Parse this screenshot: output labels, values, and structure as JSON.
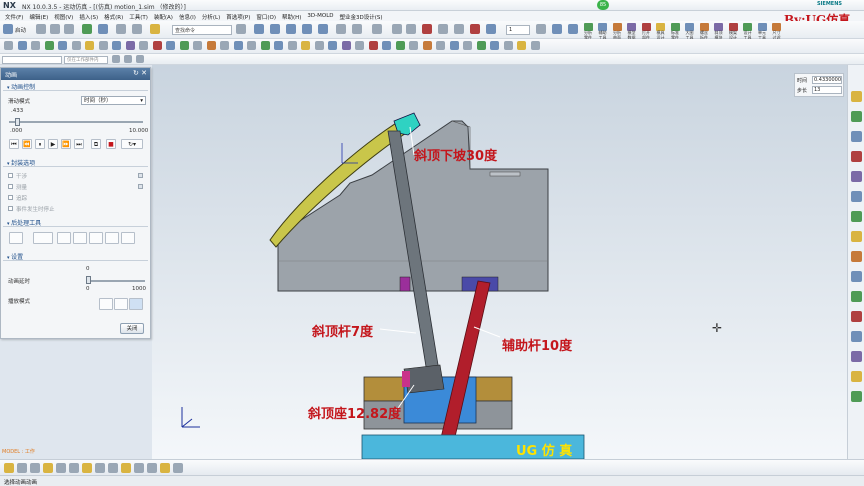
{
  "app": {
    "logo": "NX",
    "title": "NX 10.0.3.5 - 运动仿真 - [(仿真) motion_1.sim （修改的）]",
    "vendor": "SIEMENS",
    "badge": "85",
    "watermark": "By:UG仿真"
  },
  "menu": [
    "文件(F)",
    "编辑(E)",
    "视图(V)",
    "插入(S)",
    "格式(R)",
    "工具(T)",
    "装配(A)",
    "信息(I)",
    "分析(L)",
    "首选项(P)",
    "窗口(O)",
    "帮助(H)",
    "3D-MOLD",
    "塑业金3D设计(S)"
  ],
  "toolbar": {
    "start_menu": "启动",
    "search_placeholder": "查找命令",
    "step_value": "1",
    "filter_placeholder": "仅在工作部件内"
  },
  "ribbon_groups": [
    "分析\n零件",
    "辅助\n工具",
    "分析\n曲面",
    "模型\n数据",
    "打开\n部件",
    "模具\n设计",
    "标准\n零件",
    "大图\n工具",
    "螺丝\n拆件",
    "斜顶\n模块",
    "模架\n设计",
    "设计\n工具",
    "单元\n工具",
    "尺寸\n过滤"
  ],
  "dialog": {
    "title": "动画",
    "sec_anim": "动画控制",
    "playback_mode_label": "滑动模式",
    "playback_mode_value": "时间（秒）",
    "slider_value": ".433",
    "slider_min": ".000",
    "slider_max": "10.000",
    "sec_pkg": "封装选项",
    "pkg_opts": [
      "干涉",
      "测量",
      "追踪",
      "事件发生时停止"
    ],
    "sec_post": "后处理工具",
    "sec_settings": "设置",
    "delay_label": "动画延时",
    "delay_top": "0",
    "delay_min": "0",
    "delay_max": "1000",
    "mode_label": "播放模式",
    "close_label": "关闭"
  },
  "viewport": {
    "time_label": "时间",
    "time_value": "0.4330000",
    "step_label": "步长",
    "step_value": "13",
    "annotations": {
      "a1": "斜顶下坡30度",
      "a2": "斜顶杆7度",
      "a3": "辅助杆10度",
      "a4": "斜顶座12.82度"
    },
    "ug_label": "UG 仿 真",
    "model_label": "MODEL : 工作"
  },
  "status": {
    "text": "选择动画动画"
  }
}
